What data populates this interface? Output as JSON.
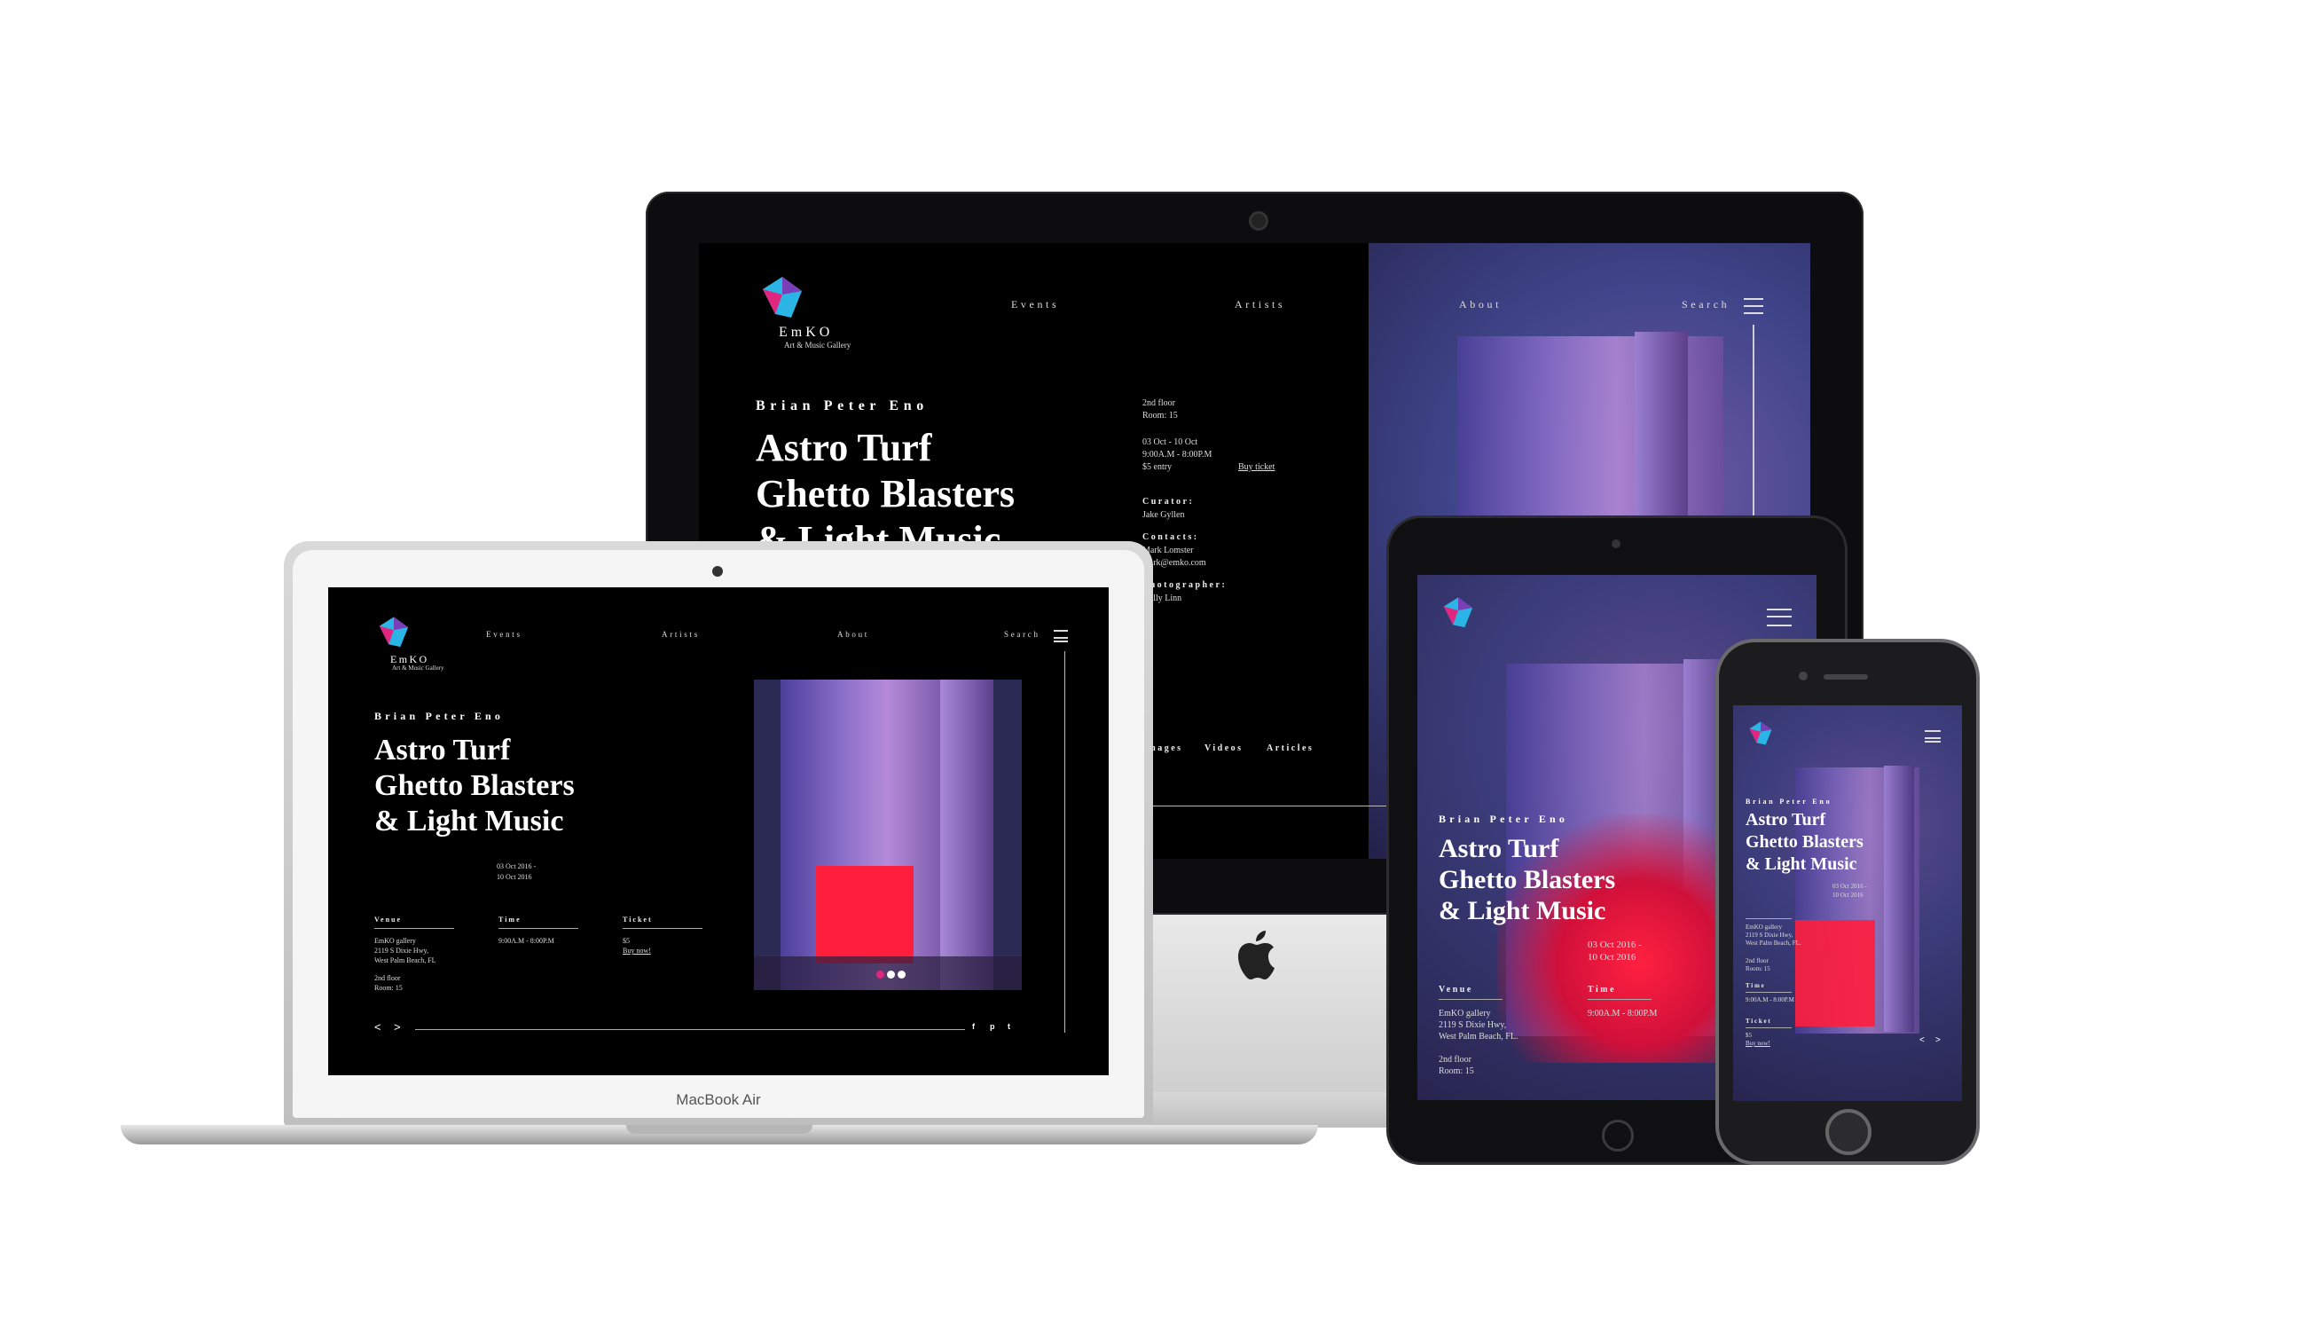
{
  "brand": {
    "name": "EmKO",
    "tagline": "Art & Music Gallery",
    "accent": "#e0267f"
  },
  "nav": {
    "events": "Events",
    "artists": "Artists",
    "about": "About",
    "search": "Search"
  },
  "event": {
    "artist": "Brian Peter Eno",
    "title_lines": [
      "Astro Turf",
      "Ghetto Blasters",
      "& Light Music"
    ],
    "floor_sup": "2nd floor",
    "room": "Room: 15",
    "dates_range": "03 Oct - 10 Oct",
    "hours": "9:00A.M - 8:00P.M",
    "price_entry": "$5 entry",
    "buy_ticket": "Buy ticket",
    "curator_label": "Curator:",
    "curator": "Jake Gyllen",
    "contacts_label": "Contacts:",
    "contact_name": "Mark Lomster",
    "contact_email": "mark@emko.com",
    "photographer_label": "Photographer:",
    "photographer": "Holly Linn",
    "media_tabs": [
      "Images",
      "Videos",
      "Articles"
    ]
  },
  "laptop": {
    "dates": [
      "03 Oct 2016 -",
      "10 Oct 2016"
    ],
    "venue_label": "Venue",
    "venue_lines": [
      "EmKO gallery",
      "2119 S Dixie Hwy,",
      "West Palm Beach, FL"
    ],
    "floor": "2nd floor",
    "room": "Room: 15",
    "time_label": "Time",
    "time": "9:00A.M - 8:00P.M",
    "ticket_label": "Ticket",
    "price": "$5",
    "buy_now": "Buy now!",
    "prev": "<",
    "next": ">",
    "device_label": "MacBook Air"
  },
  "tablet": {
    "dates": [
      "03 Oct 2016 -",
      "10 Oct 2016"
    ],
    "venue_label": "Venue",
    "venue_lines": [
      "EmKO gallery",
      "2119 S Dixie Hwy,",
      "West Palm Beach, FL."
    ],
    "floor": "2nd floor",
    "room": "Room: 15",
    "time_label": "Time",
    "time": "9:00A.M - 8:00P.M"
  },
  "phone": {
    "dates": [
      "03 Oct 2016 -",
      "10 Oct 2016"
    ],
    "venue_lines": [
      "EmKO gallery",
      "2119 S Dixie Hwy,",
      "West Palm Beach, FL."
    ],
    "floor": "2nd floor",
    "room": "Room: 15",
    "time_label": "Time",
    "time": "9:00A.M - 8:00P.M",
    "ticket_label": "Ticket",
    "price": "$5",
    "buy_now": "Buy now!",
    "prev": "<",
    "next": ">"
  },
  "icons": [
    "logo-icon",
    "menu-icon",
    "facebook-icon",
    "pinterest-icon",
    "twitter-icon",
    "apple-logo-icon"
  ]
}
